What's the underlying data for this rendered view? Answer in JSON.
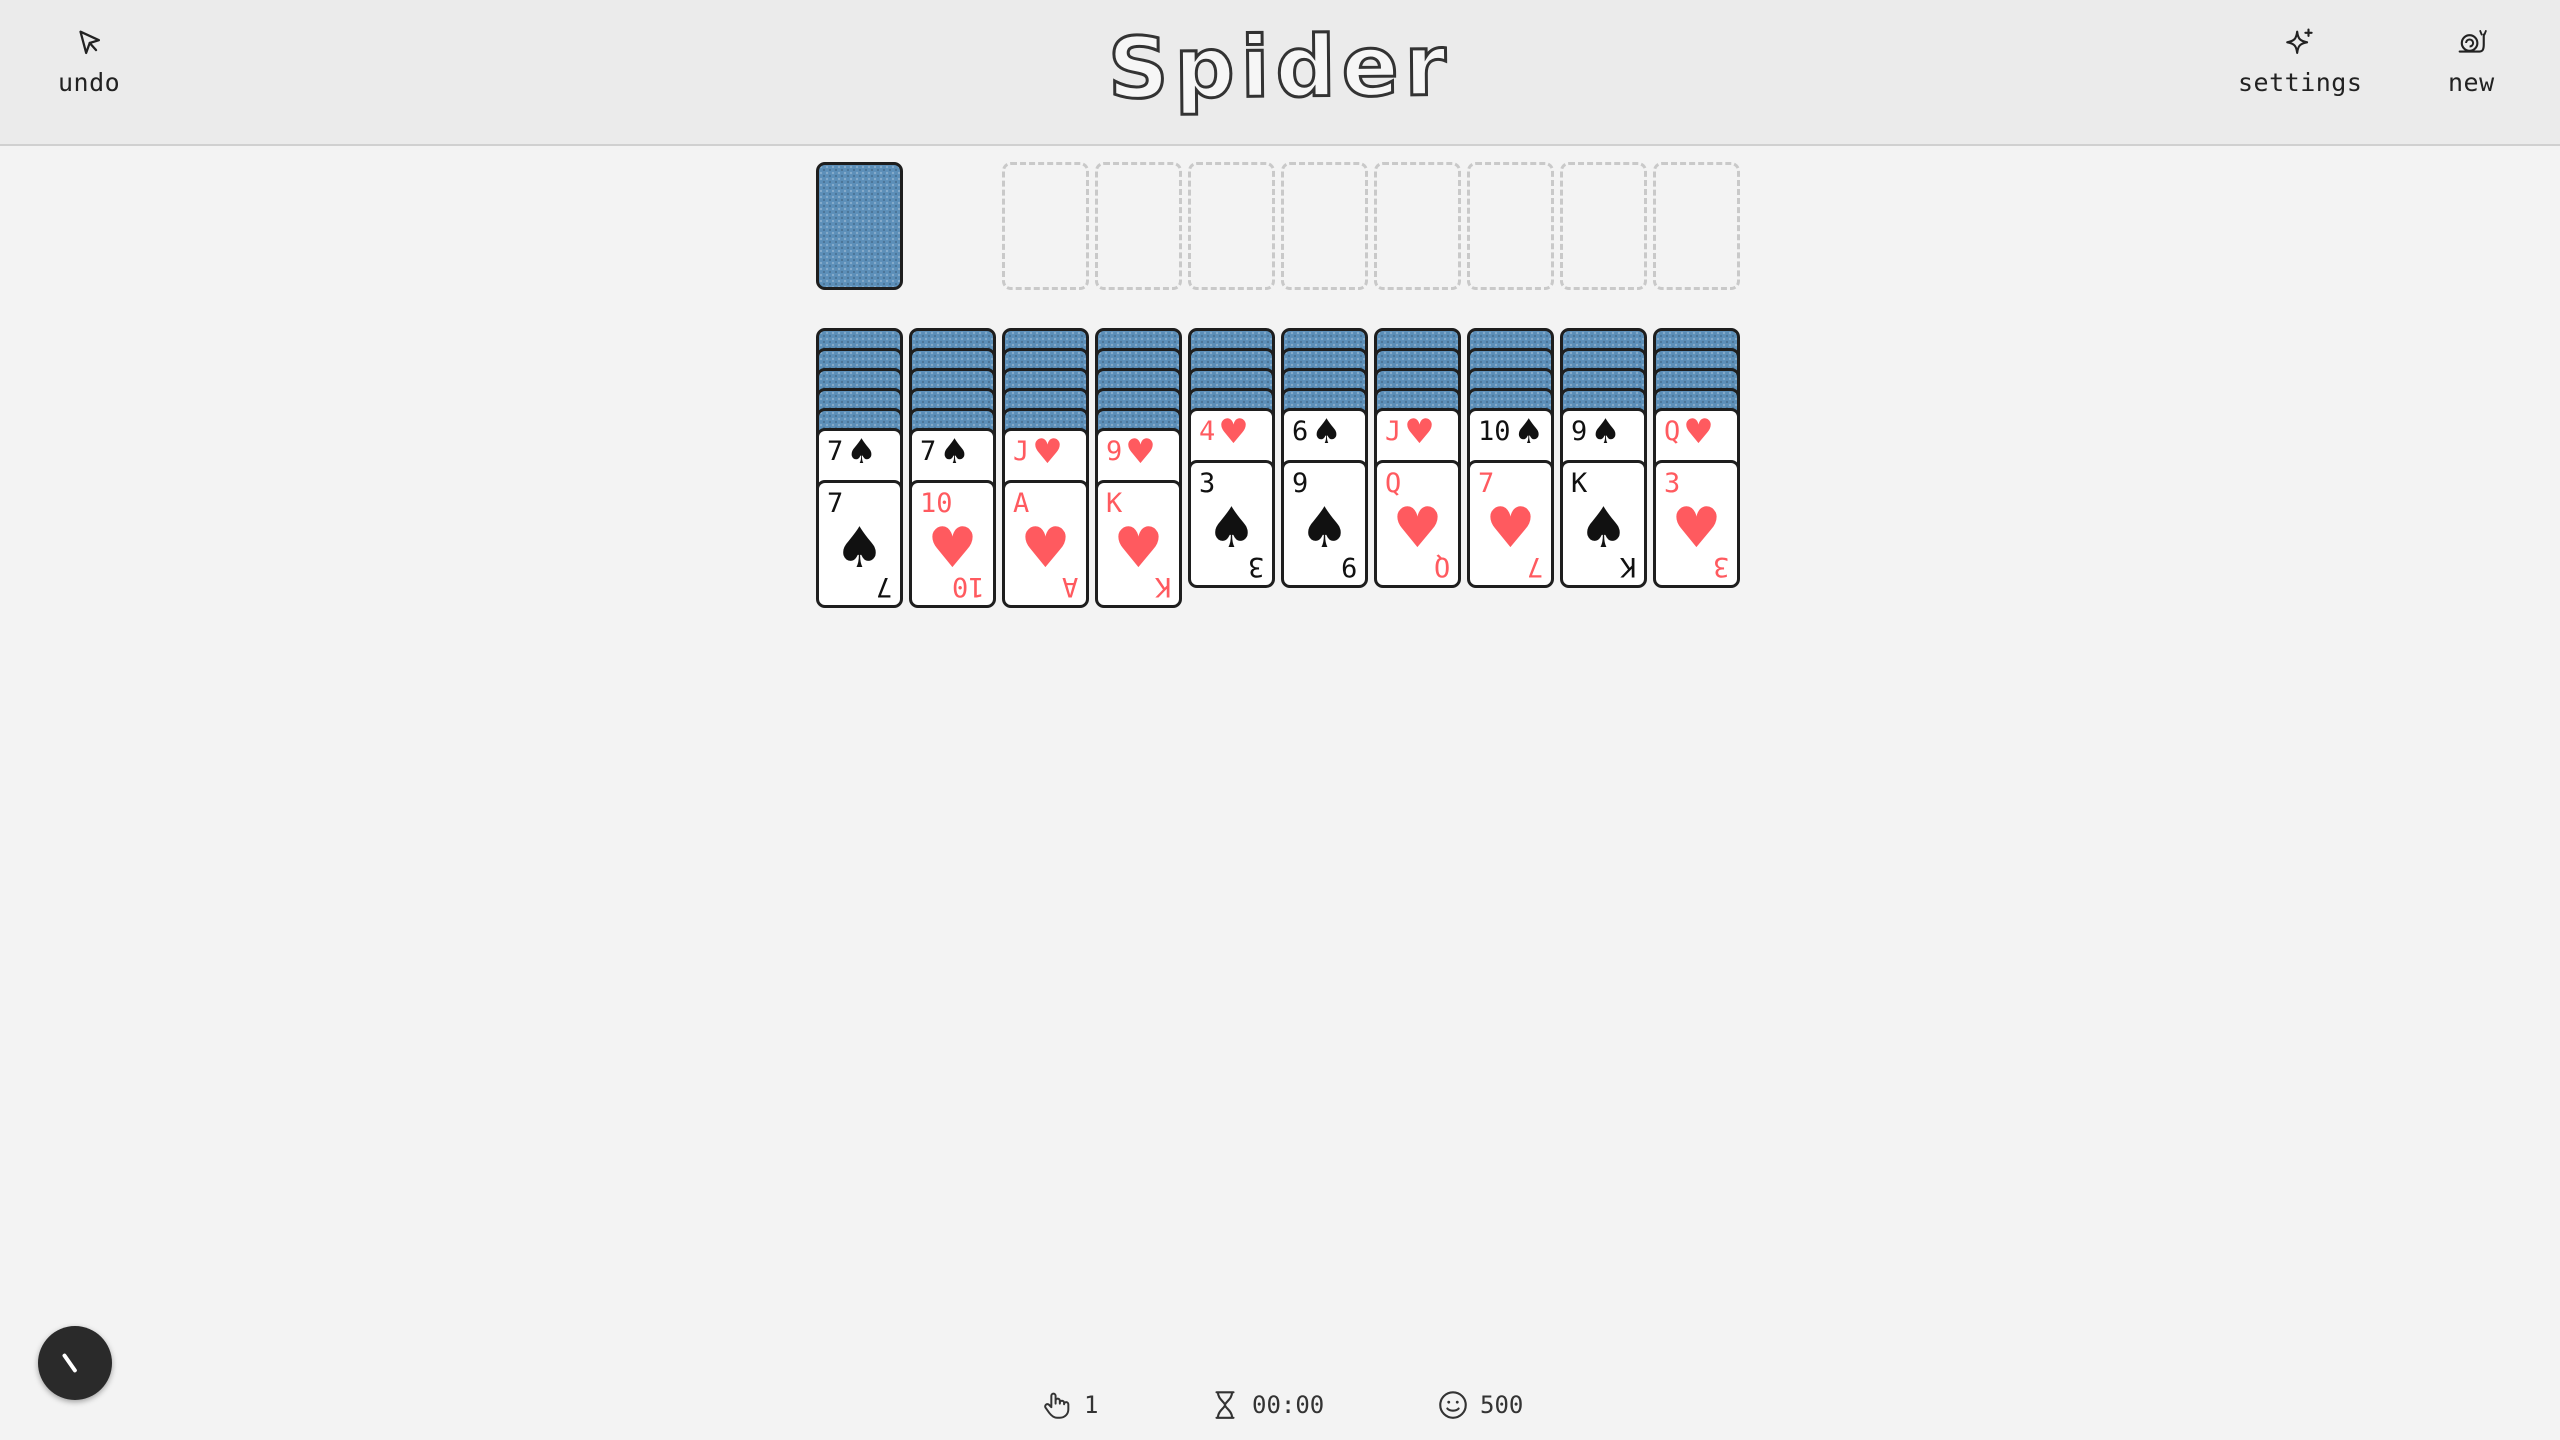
{
  "header": {
    "title": "Spider",
    "undo_label": "undo",
    "settings_label": "settings",
    "new_label": "new"
  },
  "stock": {
    "count_visible": 1
  },
  "foundations": {
    "empty_slots": 8
  },
  "tableau": [
    {
      "face_down": 5,
      "face_up": [
        {
          "rank": "7",
          "suit": "spades"
        },
        {
          "rank": "7",
          "suit": "spades"
        }
      ]
    },
    {
      "face_down": 5,
      "face_up": [
        {
          "rank": "7",
          "suit": "spades"
        },
        {
          "rank": "10",
          "suit": "hearts"
        }
      ]
    },
    {
      "face_down": 5,
      "face_up": [
        {
          "rank": "J",
          "suit": "hearts"
        },
        {
          "rank": "A",
          "suit": "hearts"
        }
      ]
    },
    {
      "face_down": 5,
      "face_up": [
        {
          "rank": "9",
          "suit": "hearts"
        },
        {
          "rank": "K",
          "suit": "hearts"
        }
      ]
    },
    {
      "face_down": 4,
      "face_up": [
        {
          "rank": "4",
          "suit": "hearts"
        },
        {
          "rank": "3",
          "suit": "spades"
        }
      ]
    },
    {
      "face_down": 4,
      "face_up": [
        {
          "rank": "6",
          "suit": "spades"
        },
        {
          "rank": "9",
          "suit": "spades"
        }
      ]
    },
    {
      "face_down": 4,
      "face_up": [
        {
          "rank": "J",
          "suit": "hearts"
        },
        {
          "rank": "Q",
          "suit": "hearts"
        }
      ]
    },
    {
      "face_down": 4,
      "face_up": [
        {
          "rank": "10",
          "suit": "spades"
        },
        {
          "rank": "7",
          "suit": "hearts"
        }
      ]
    },
    {
      "face_down": 4,
      "face_up": [
        {
          "rank": "9",
          "suit": "spades"
        },
        {
          "rank": "K",
          "suit": "spades"
        }
      ]
    },
    {
      "face_down": 4,
      "face_up": [
        {
          "rank": "Q",
          "suit": "hearts"
        },
        {
          "rank": "3",
          "suit": "hearts"
        }
      ]
    }
  ],
  "status": {
    "moves": "1",
    "time": "00:00",
    "score": "500"
  },
  "colors": {
    "card_back": "#5c8fb9",
    "red_suit": "#ff5a5f",
    "black_suit": "#111111",
    "background": "#f3f3f3"
  }
}
